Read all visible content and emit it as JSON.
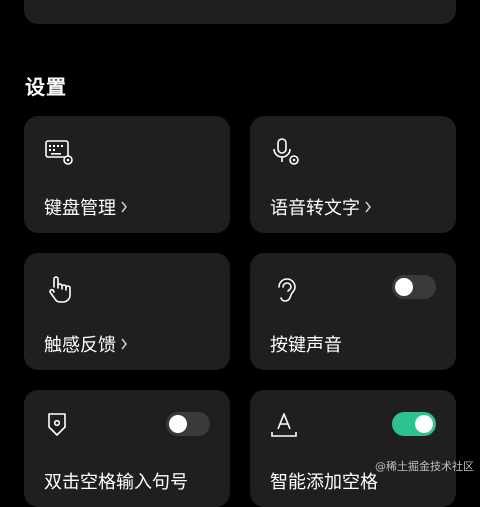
{
  "section_title": "设置",
  "cards": {
    "keyboard": {
      "label": "键盘管理",
      "icon": "keyboard-settings-icon"
    },
    "voice": {
      "label": "语音转文字",
      "icon": "microphone-settings-icon"
    },
    "haptic": {
      "label": "触感反馈",
      "icon": "touch-hand-icon"
    },
    "sound": {
      "label": "按键声音",
      "icon": "ear-icon",
      "toggle_on": false
    },
    "double_space": {
      "label": "双击空格输入句号",
      "icon": "shield-location-icon",
      "toggle_on": false
    },
    "smart_space": {
      "label": "智能添加空格",
      "icon": "text-format-icon",
      "toggle_on": true
    }
  },
  "colors": {
    "accent": "#2bc28f",
    "card": "#1f1f1f",
    "background": "#000000"
  },
  "watermark": "@稀土掘金技术社区"
}
